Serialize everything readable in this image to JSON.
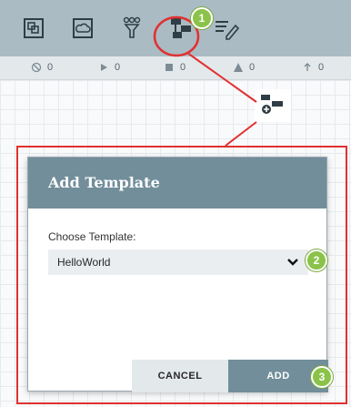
{
  "status": {
    "disabled_count": "0",
    "running_count": "0",
    "stopped_count": "0",
    "invalid_count": "0",
    "upload_count": "0"
  },
  "dialog": {
    "title": "Add Template",
    "field_label": "Choose Template:",
    "selected_template": "HelloWorld",
    "cancel_label": "CANCEL",
    "add_label": "ADD"
  },
  "callouts": {
    "one": "1",
    "two": "2",
    "three": "3"
  },
  "colors": {
    "toolbar": "#aabbc3",
    "dialog_header": "#728e9b",
    "callout": "#8bc34a",
    "annotation_red": "#e03131"
  }
}
